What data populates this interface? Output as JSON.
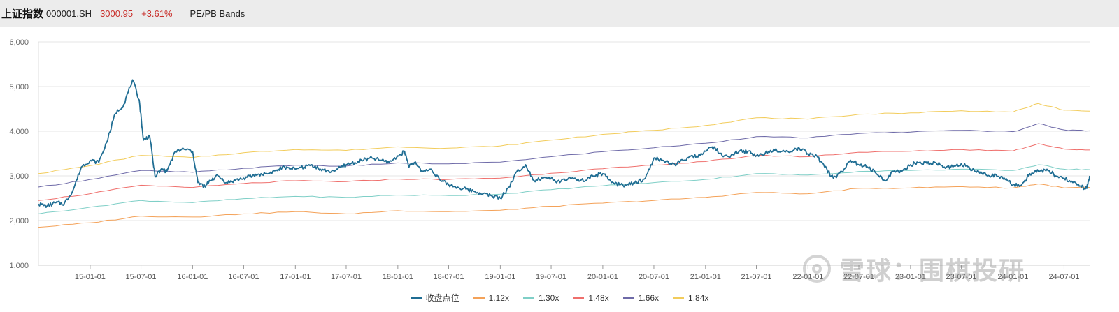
{
  "header": {
    "index_name": "上证指数",
    "index_code": "000001.SH",
    "price": "3000.95",
    "change": "+3.61%",
    "chart_title": "PE/PB Bands"
  },
  "watermark": {
    "text": "雪球：围棋投研"
  },
  "chart_data": {
    "type": "line",
    "title": "",
    "xlabel": "",
    "ylabel": "",
    "ylim": [
      1000,
      6000
    ],
    "yticks": [
      1000,
      2000,
      3000,
      4000,
      5000,
      6000
    ],
    "ytick_labels": [
      "1,000",
      "2,000",
      "3,000",
      "4,000",
      "5,000",
      "6,000"
    ],
    "x_start": "2014-07",
    "x_end": "2024-09",
    "xtick_labels": [
      "15-01-01",
      "15-07-01",
      "16-01-01",
      "16-07-01",
      "17-01-01",
      "17-07-01",
      "18-01-01",
      "18-07-01",
      "19-01-01",
      "19-07-01",
      "20-01-01",
      "20-07-01",
      "21-01-01",
      "21-07-01",
      "22-01-01",
      "22-07-01",
      "23-01-01",
      "23-07-01",
      "24-01-01",
      "24-07-01"
    ],
    "grid": true,
    "legend_position": "bottom",
    "series": [
      {
        "name": "收盘点位",
        "color": "#1f6d93",
        "points": [
          [
            "2014-07-01",
            2370
          ],
          [
            "2014-08-01",
            2330
          ],
          [
            "2014-09-01",
            2400
          ],
          [
            "2014-10-01",
            2380
          ],
          [
            "2014-11-01",
            2680
          ],
          [
            "2014-12-01",
            3200
          ],
          [
            "2015-01-01",
            3350
          ],
          [
            "2015-02-01",
            3300
          ],
          [
            "2015-03-01",
            3750
          ],
          [
            "2015-04-01",
            4400
          ],
          [
            "2015-05-01",
            4600
          ],
          [
            "2015-06-01",
            5150
          ],
          [
            "2015-06-25",
            4700
          ],
          [
            "2015-07-10",
            3800
          ],
          [
            "2015-08-01",
            3900
          ],
          [
            "2015-08-20",
            3000
          ],
          [
            "2015-09-15",
            3150
          ],
          [
            "2015-10-01",
            3100
          ],
          [
            "2015-11-01",
            3550
          ],
          [
            "2015-12-01",
            3600
          ],
          [
            "2016-01-01",
            3550
          ],
          [
            "2016-01-20",
            2850
          ],
          [
            "2016-02-15",
            2750
          ],
          [
            "2016-03-01",
            2900
          ],
          [
            "2016-04-01",
            3000
          ],
          [
            "2016-05-01",
            2850
          ],
          [
            "2016-06-01",
            2900
          ],
          [
            "2016-07-01",
            2950
          ],
          [
            "2016-08-01",
            3000
          ],
          [
            "2016-09-01",
            3050
          ],
          [
            "2016-10-01",
            3050
          ],
          [
            "2016-11-01",
            3150
          ],
          [
            "2016-12-01",
            3200
          ],
          [
            "2017-01-01",
            3150
          ],
          [
            "2017-02-01",
            3200
          ],
          [
            "2017-03-01",
            3250
          ],
          [
            "2017-04-01",
            3150
          ],
          [
            "2017-05-01",
            3100
          ],
          [
            "2017-06-01",
            3150
          ],
          [
            "2017-07-01",
            3250
          ],
          [
            "2017-08-01",
            3300
          ],
          [
            "2017-09-01",
            3350
          ],
          [
            "2017-10-01",
            3400
          ],
          [
            "2017-11-01",
            3350
          ],
          [
            "2017-12-01",
            3300
          ],
          [
            "2018-01-01",
            3450
          ],
          [
            "2018-01-25",
            3550
          ],
          [
            "2018-02-10",
            3200
          ],
          [
            "2018-03-01",
            3300
          ],
          [
            "2018-04-01",
            3100
          ],
          [
            "2018-05-01",
            3150
          ],
          [
            "2018-06-01",
            2900
          ],
          [
            "2018-07-01",
            2800
          ],
          [
            "2018-08-01",
            2750
          ],
          [
            "2018-09-01",
            2700
          ],
          [
            "2018-10-01",
            2650
          ],
          [
            "2018-11-01",
            2600
          ],
          [
            "2018-12-01",
            2550
          ],
          [
            "2019-01-01",
            2500
          ],
          [
            "2019-02-01",
            2750
          ],
          [
            "2019-03-01",
            3100
          ],
          [
            "2019-04-01",
            3250
          ],
          [
            "2019-05-01",
            2900
          ],
          [
            "2019-06-01",
            2950
          ],
          [
            "2019-07-01",
            2950
          ],
          [
            "2019-08-01",
            2850
          ],
          [
            "2019-09-01",
            2950
          ],
          [
            "2019-10-01",
            2900
          ],
          [
            "2019-11-01",
            2900
          ],
          [
            "2019-12-01",
            3000
          ],
          [
            "2020-01-01",
            3050
          ],
          [
            "2020-02-01",
            2850
          ],
          [
            "2020-03-01",
            2800
          ],
          [
            "2020-04-01",
            2800
          ],
          [
            "2020-05-01",
            2850
          ],
          [
            "2020-06-01",
            2950
          ],
          [
            "2020-07-01",
            3400
          ],
          [
            "2020-08-01",
            3350
          ],
          [
            "2020-09-01",
            3250
          ],
          [
            "2020-10-01",
            3300
          ],
          [
            "2020-11-01",
            3400
          ],
          [
            "2020-12-01",
            3450
          ],
          [
            "2021-01-01",
            3550
          ],
          [
            "2021-02-01",
            3650
          ],
          [
            "2021-03-01",
            3450
          ],
          [
            "2021-04-01",
            3450
          ],
          [
            "2021-05-01",
            3550
          ],
          [
            "2021-06-01",
            3550
          ],
          [
            "2021-07-01",
            3450
          ],
          [
            "2021-08-01",
            3500
          ],
          [
            "2021-09-01",
            3600
          ],
          [
            "2021-10-01",
            3550
          ],
          [
            "2021-11-01",
            3550
          ],
          [
            "2021-12-01",
            3620
          ],
          [
            "2022-01-01",
            3500
          ],
          [
            "2022-02-01",
            3450
          ],
          [
            "2022-03-01",
            3200
          ],
          [
            "2022-04-01",
            2950
          ],
          [
            "2022-05-01",
            3100
          ],
          [
            "2022-06-01",
            3350
          ],
          [
            "2022-07-01",
            3250
          ],
          [
            "2022-08-01",
            3200
          ],
          [
            "2022-09-01",
            3050
          ],
          [
            "2022-10-01",
            2900
          ],
          [
            "2022-11-01",
            3100
          ],
          [
            "2022-12-01",
            3100
          ],
          [
            "2023-01-01",
            3250
          ],
          [
            "2023-02-01",
            3300
          ],
          [
            "2023-03-01",
            3270
          ],
          [
            "2023-04-01",
            3300
          ],
          [
            "2023-05-01",
            3200
          ],
          [
            "2023-06-01",
            3200
          ],
          [
            "2023-07-01",
            3280
          ],
          [
            "2023-08-01",
            3150
          ],
          [
            "2023-09-01",
            3100
          ],
          [
            "2023-10-01",
            3000
          ],
          [
            "2023-11-01",
            3030
          ],
          [
            "2023-12-01",
            2950
          ],
          [
            "2024-01-01",
            2800
          ],
          [
            "2024-02-01",
            2800
          ],
          [
            "2024-03-01",
            3050
          ],
          [
            "2024-04-01",
            3100
          ],
          [
            "2024-05-01",
            3150
          ],
          [
            "2024-06-01",
            3000
          ],
          [
            "2024-07-01",
            2950
          ],
          [
            "2024-08-01",
            2850
          ],
          [
            "2024-09-01",
            2750
          ],
          [
            "2024-09-20",
            2720
          ],
          [
            "2024-09-30",
            3000
          ]
        ]
      },
      {
        "name": "1.12x",
        "color": "#f4a259",
        "points": [
          [
            "2014-07-01",
            1850
          ],
          [
            "2015-01-01",
            1950
          ],
          [
            "2015-07-01",
            2100
          ],
          [
            "2016-01-01",
            2080
          ],
          [
            "2016-07-01",
            2150
          ],
          [
            "2017-01-01",
            2200
          ],
          [
            "2017-07-01",
            2150
          ],
          [
            "2018-01-01",
            2220
          ],
          [
            "2018-07-01",
            2200
          ],
          [
            "2019-01-01",
            2230
          ],
          [
            "2019-07-01",
            2320
          ],
          [
            "2020-01-01",
            2390
          ],
          [
            "2020-07-01",
            2450
          ],
          [
            "2021-01-01",
            2520
          ],
          [
            "2021-07-01",
            2630
          ],
          [
            "2022-01-01",
            2600
          ],
          [
            "2022-07-01",
            2720
          ],
          [
            "2023-01-01",
            2730
          ],
          [
            "2023-07-01",
            2760
          ],
          [
            "2024-01-01",
            2730
          ],
          [
            "2024-04-01",
            2820
          ],
          [
            "2024-07-01",
            2730
          ],
          [
            "2024-09-30",
            2740
          ]
        ]
      },
      {
        "name": "1.30x",
        "color": "#7fcfc7",
        "points": [
          [
            "2014-07-01",
            2150
          ],
          [
            "2015-01-01",
            2300
          ],
          [
            "2015-07-01",
            2450
          ],
          [
            "2016-01-01",
            2400
          ],
          [
            "2016-07-01",
            2490
          ],
          [
            "2017-01-01",
            2540
          ],
          [
            "2017-07-01",
            2520
          ],
          [
            "2018-01-01",
            2570
          ],
          [
            "2018-07-01",
            2560
          ],
          [
            "2019-01-01",
            2590
          ],
          [
            "2019-07-01",
            2690
          ],
          [
            "2020-01-01",
            2780
          ],
          [
            "2020-07-01",
            2850
          ],
          [
            "2021-01-01",
            2920
          ],
          [
            "2021-07-01",
            3050
          ],
          [
            "2022-01-01",
            3020
          ],
          [
            "2022-07-01",
            3100
          ],
          [
            "2023-01-01",
            3120
          ],
          [
            "2023-07-01",
            3150
          ],
          [
            "2024-01-01",
            3120
          ],
          [
            "2024-04-01",
            3250
          ],
          [
            "2024-07-01",
            3150
          ],
          [
            "2024-09-30",
            3140
          ]
        ]
      },
      {
        "name": "1.48x",
        "color": "#ef6f6c",
        "points": [
          [
            "2014-07-01",
            2450
          ],
          [
            "2015-01-01",
            2600
          ],
          [
            "2015-07-01",
            2790
          ],
          [
            "2016-01-01",
            2740
          ],
          [
            "2016-07-01",
            2830
          ],
          [
            "2017-01-01",
            2890
          ],
          [
            "2017-07-01",
            2870
          ],
          [
            "2018-01-01",
            2930
          ],
          [
            "2018-07-01",
            2920
          ],
          [
            "2019-01-01",
            2950
          ],
          [
            "2019-07-01",
            3060
          ],
          [
            "2020-01-01",
            3160
          ],
          [
            "2020-07-01",
            3240
          ],
          [
            "2021-01-01",
            3320
          ],
          [
            "2021-07-01",
            3460
          ],
          [
            "2022-01-01",
            3430
          ],
          [
            "2022-07-01",
            3530
          ],
          [
            "2023-01-01",
            3550
          ],
          [
            "2023-07-01",
            3590
          ],
          [
            "2024-01-01",
            3560
          ],
          [
            "2024-04-01",
            3720
          ],
          [
            "2024-07-01",
            3600
          ],
          [
            "2024-09-30",
            3580
          ]
        ]
      },
      {
        "name": "1.66x",
        "color": "#6e6aa8",
        "points": [
          [
            "2014-07-01",
            2750
          ],
          [
            "2015-01-01",
            2920
          ],
          [
            "2015-07-01",
            3120
          ],
          [
            "2016-01-01",
            3080
          ],
          [
            "2016-07-01",
            3170
          ],
          [
            "2017-01-01",
            3240
          ],
          [
            "2017-07-01",
            3220
          ],
          [
            "2018-01-01",
            3290
          ],
          [
            "2018-07-01",
            3270
          ],
          [
            "2019-01-01",
            3310
          ],
          [
            "2019-07-01",
            3430
          ],
          [
            "2020-01-01",
            3540
          ],
          [
            "2020-07-01",
            3630
          ],
          [
            "2021-01-01",
            3730
          ],
          [
            "2021-07-01",
            3880
          ],
          [
            "2022-01-01",
            3850
          ],
          [
            "2022-07-01",
            3950
          ],
          [
            "2023-01-01",
            3980
          ],
          [
            "2023-07-01",
            4020
          ],
          [
            "2024-01-01",
            3990
          ],
          [
            "2024-04-01",
            4170
          ],
          [
            "2024-07-01",
            4030
          ],
          [
            "2024-09-30",
            4010
          ]
        ]
      },
      {
        "name": "1.84x",
        "color": "#f2cc5b",
        "points": [
          [
            "2014-07-01",
            3050
          ],
          [
            "2015-01-01",
            3230
          ],
          [
            "2015-07-01",
            3460
          ],
          [
            "2016-01-01",
            3410
          ],
          [
            "2016-07-01",
            3520
          ],
          [
            "2017-01-01",
            3590
          ],
          [
            "2017-07-01",
            3570
          ],
          [
            "2018-01-01",
            3650
          ],
          [
            "2018-07-01",
            3620
          ],
          [
            "2019-01-01",
            3670
          ],
          [
            "2019-07-01",
            3800
          ],
          [
            "2020-01-01",
            3930
          ],
          [
            "2020-07-01",
            4020
          ],
          [
            "2021-01-01",
            4130
          ],
          [
            "2021-07-01",
            4300
          ],
          [
            "2022-01-01",
            4270
          ],
          [
            "2022-07-01",
            4380
          ],
          [
            "2023-01-01",
            4410
          ],
          [
            "2023-07-01",
            4460
          ],
          [
            "2024-01-01",
            4430
          ],
          [
            "2024-04-01",
            4620
          ],
          [
            "2024-07-01",
            4470
          ],
          [
            "2024-09-30",
            4450
          ]
        ]
      }
    ]
  }
}
